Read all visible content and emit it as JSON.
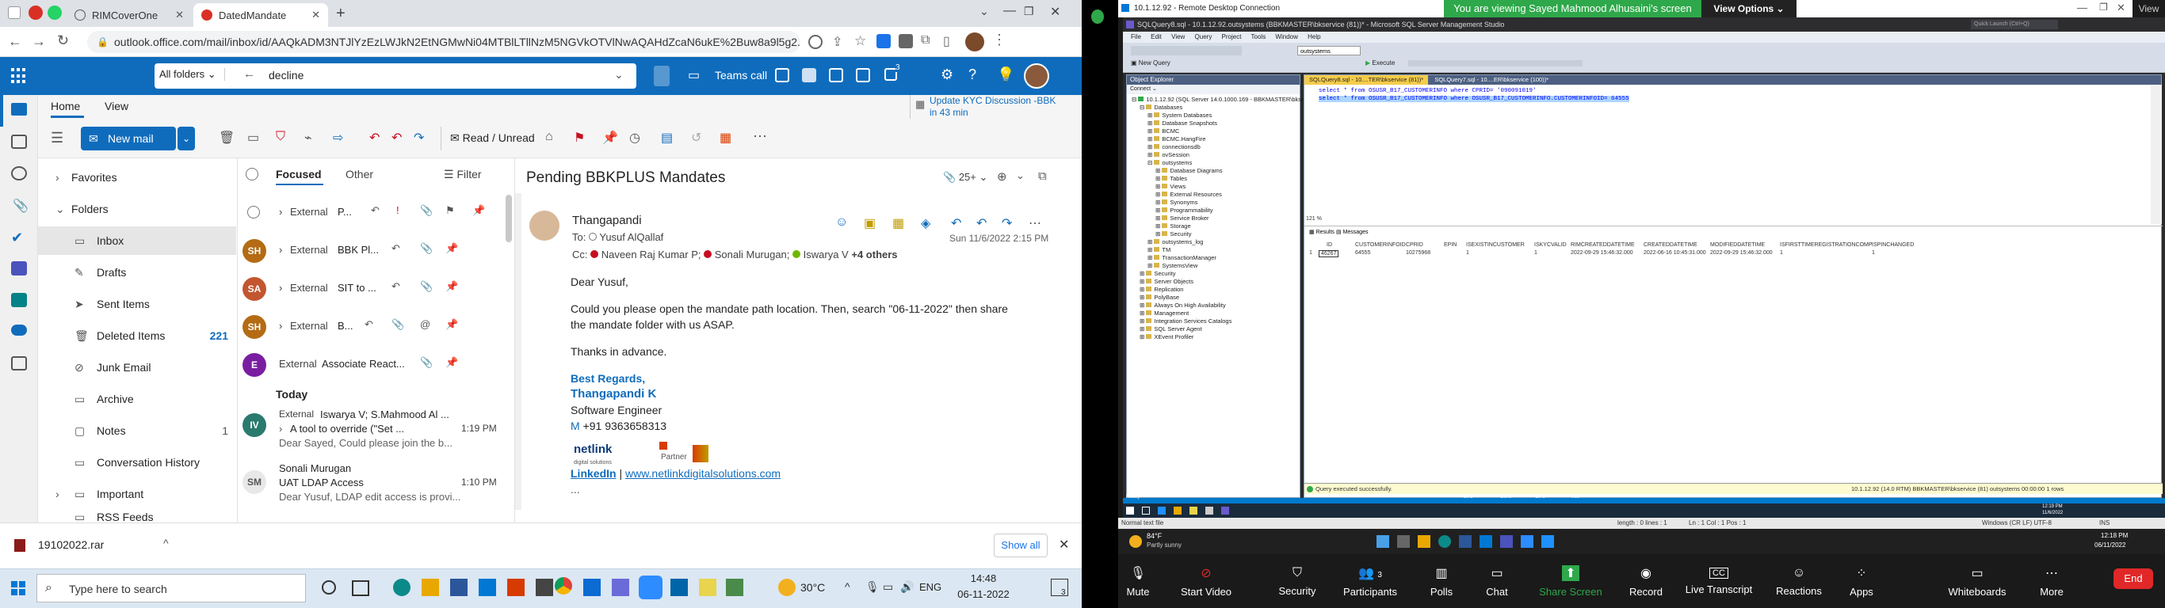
{
  "browser": {
    "tabs": [
      {
        "label": "RIMCoverOne"
      },
      {
        "label": "DatedMandate"
      }
    ],
    "url": "outlook.office.com/mail/inbox/id/AAQkADM3NTJlYzEzLWJkN2EtNGMwNi04MTBlLTllNzM5NGVkOTVlNwAQAHdZcaN6ukE%2Buw8a9l5g2..."
  },
  "outlook": {
    "search_scope": "All folders",
    "search_query": "decline",
    "teams_call": "Teams call",
    "reminder_title": "Update KYC Discussion -BBK",
    "reminder_time": "in 43 min",
    "ribbon_tabs": [
      "Home",
      "View"
    ],
    "new_mail": "New mail",
    "read_unread": "Read / Unread",
    "folders": {
      "favorites": "Favorites",
      "folders_header": "Folders",
      "items": [
        {
          "name": "Inbox",
          "count": ""
        },
        {
          "name": "Drafts",
          "count": ""
        },
        {
          "name": "Sent Items",
          "count": ""
        },
        {
          "name": "Deleted Items",
          "count": "221"
        },
        {
          "name": "Junk Email",
          "count": ""
        },
        {
          "name": "Archive",
          "count": ""
        },
        {
          "name": "Notes",
          "count": "1"
        },
        {
          "name": "Conversation History",
          "count": ""
        },
        {
          "name": "Important",
          "count": ""
        },
        {
          "name": "RSS Feeds",
          "count": ""
        }
      ]
    },
    "list": {
      "focused": "Focused",
      "other": "Other",
      "filter": "Filter",
      "today": "Today",
      "external": "External",
      "rows": [
        {
          "initials": "",
          "subject": "P...",
          "color": "#ffffff"
        },
        {
          "initials": "SH",
          "subject": "BBK Pl...",
          "color": "#b46b14"
        },
        {
          "initials": "SA",
          "subject": "SIT to ...",
          "color": "#c2562f"
        },
        {
          "initials": "SH",
          "subject": "B...",
          "color": "#b46b14"
        },
        {
          "initials": "E",
          "subject": "Associate React...",
          "color": "#7a1ea1"
        }
      ],
      "today_rows": [
        {
          "initials": "IV",
          "sender": "Iswarya V; S.Mahmood Al ...",
          "subject": "A tool to override (\"Set ...",
          "time": "1:19 PM",
          "preview": "Dear Sayed, Could please join the b...",
          "color": "#2a7a6e"
        },
        {
          "initials": "SM",
          "sender": "Sonali Murugan",
          "subject": "UAT LDAP Access",
          "time": "1:10 PM",
          "preview": "Dear Yusuf, LDAP edit access is provi...",
          "color": "#e8e8e8"
        }
      ]
    },
    "reading": {
      "subject": "Pending BBKPLUS Mandates",
      "count": "25+",
      "from": "Thangapandi",
      "to_label": "To:",
      "to": "Yusuf AlQallaf",
      "cc_label": "Cc:",
      "cc1": "Naveen Raj Kumar P;",
      "cc2": "Sonali Murugan;",
      "cc3": "Iswarya V",
      "more": "+4 others",
      "date": "Sun 11/6/2022 2:15 PM",
      "greeting": "Dear Yusuf,",
      "body1": "Could you please open the mandate path location. Then, search \"06-11-2022\" then share",
      "body2": "the mandate folder with us ASAP.",
      "thanks": "Thanks in advance.",
      "regards": "Best Regards,",
      "sig_name": "Thangapandi K",
      "sig_title": "Software Engineer",
      "sig_m": "M",
      "sig_phone": "+91 9363658313",
      "logo": "netlink",
      "logo_sub": "digital solutions",
      "partner": "Partner",
      "linkedin": "LinkedIn",
      "sep": "|",
      "website": "www.netlinkdigitalsolutions.com",
      "ellipsis": "..."
    },
    "download": {
      "file": "19102022.rar",
      "show_all": "Show all"
    }
  },
  "taskbar": {
    "search": "Type here to search",
    "weather": "30°C",
    "lang": "ENG",
    "time": "14:48",
    "date": "06-11-2022",
    "notif": "3"
  },
  "rdp": {
    "title": "10.1.12.92 - Remote Desktop Connection",
    "banner": "You are viewing Sayed Mahmood Alhusaini's screen",
    "view_options": "View Options",
    "view_label": "View",
    "ssms_title": "SQLQuery8.sql - 10.1.12.92.outsystems (BBKMASTER\\bkservice (81))* - Microsoft SQL Server Management Studio",
    "quick_launch": "Quick Launch (Ctrl+Q)",
    "menu": "File Edit View Query Project Tools Window Help",
    "db": "outsystems",
    "execute": "Execute",
    "new_query": "New Query",
    "object_explorer": "Object Explorer",
    "connect": "Connect",
    "tree": [
      "10.1.12.92 (SQL Server 14.0.1000.169 - BBKMASTER\\bkservice)",
      "Databases",
      "System Databases",
      "Database Snapshots",
      "BCMC",
      "BCMC.HangFire",
      "connectionsdb",
      "ovSession",
      "outsystems",
      "Database Diagrams",
      "Tables",
      "Views",
      "External Resources",
      "Synonyms",
      "Programmability",
      "Service Broker",
      "Storage",
      "Security",
      "outsystems_log",
      "TM",
      "TransactionManager",
      "SystemsView",
      "Security",
      "Server Objects",
      "Replication",
      "PolyBase",
      "Always On High Availability",
      "Management",
      "Integration Services Catalogs",
      "SQL Server Agent",
      "XEvent Profiler"
    ],
    "editor_tabs": [
      "SQLQuery8.sql - 10....TER\\bkservice (81))*",
      "SQLQuery7.sql - 10....ER\\bkservice (100))*"
    ],
    "sql1": "select * from OSUSR_B17_CUSTOMERINFO where CPRID= '090091019'",
    "sql2": "select * from OSUSR_B17_CUSTOMERINFO where OSUSR_B17_CUSTOMERINFO.CUSTOMERINFOID= 64555",
    "zoom": "121 %",
    "results_tab": "Results",
    "messages_tab": "Messages",
    "grid_headers": [
      "ID",
      "CUSTOMERINFOID",
      "CPRID",
      "EPIN",
      "ISEXISTINCUSTOMER",
      "ISKYCVALID",
      "RIMCREATEDDATETIME",
      "CREATEDDATETIME",
      "MODIFIEDDATETIME",
      "ISFIRSTTIMEREGISTRATIONCOMP",
      "ISPINCHANGED"
    ],
    "grid_row": [
      "1",
      "46267",
      "64555",
      "10275968",
      "1",
      "1",
      "2022-09-29 15:46:32.000",
      "2022-06-16 10:45:31.000",
      "2022-09-29 15:46:32.000",
      "1",
      "1"
    ],
    "query_status": "Query executed successfully.",
    "status_right": "10.1.12.92 (14.0 RTM)   BBKMASTER\\bkservice (81)   outsystems   00:00:00   1 rows",
    "ready": "Ready",
    "ln": "Ln 2",
    "col": "Col 1",
    "ch": "Ch 1",
    "ins": "INS",
    "vm_time": "12:19 PM",
    "vm_date": "11/6/2022",
    "notepad": "Normal text file",
    "np_len": "length : 0    lines : 1",
    "np_pos": "Ln : 1    Col : 1    Pos : 1",
    "np_enc": "Windows (CR LF)    UTF-8",
    "np_ins": "INS",
    "weather": "84°F",
    "weather_desc": "Partly sunny",
    "host_time": "12:18 PM",
    "host_date": "06/11/2022"
  },
  "zoom": {
    "mute": "Mute",
    "video": "Start Video",
    "security": "Security",
    "participants": "Participants",
    "participants_count": "3",
    "polls": "Polls",
    "chat": "Chat",
    "share": "Share Screen",
    "record": "Record",
    "transcript": "Live Transcript",
    "reactions": "Reactions",
    "apps": "Apps",
    "whiteboards": "Whiteboards",
    "more": "More",
    "end": "End"
  }
}
